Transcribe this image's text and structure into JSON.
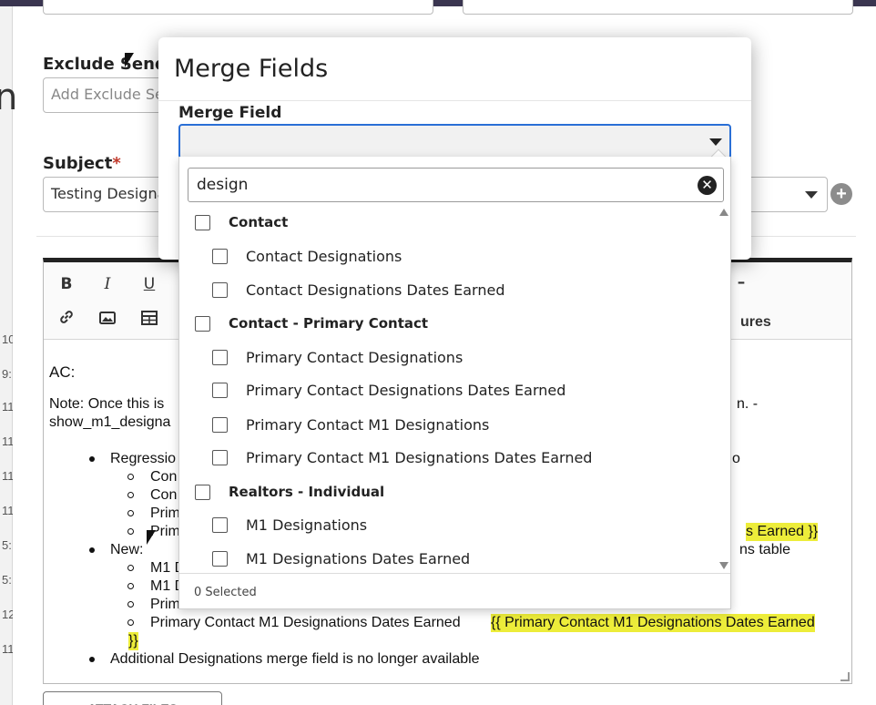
{
  "background": {
    "exclude_label": "Exclude Sendin",
    "exclude_placeholder": "Add Exclude Se",
    "subject_label": "Subject",
    "subject_required": "*",
    "subject_value": "Testing Designa",
    "big_letter": "n",
    "gutter_numbers": [
      "10",
      "9:",
      "11",
      "11",
      "11",
      "11",
      "5:",
      "5:",
      "12",
      "11"
    ]
  },
  "editor": {
    "toolbar": {
      "bold": "B",
      "italic": "I",
      "underline": "U",
      "dash": "–",
      "right_label": "ures"
    },
    "lines": {
      "ac": "AC:",
      "note_left": "Note: Once this is",
      "note_right": "n. -",
      "note_line2": "show_m1_designa",
      "regression_left": "Regressio",
      "regression_right": "o",
      "sub1": "Con",
      "sub2": "Con",
      "sub3": "Prim",
      "sub4_left": "Prim",
      "sub4_right": "s Earned }}",
      "new_left": "New:",
      "new_right": "ns table",
      "new_sub1": "M1 D",
      "new_sub2": "M1 D",
      "new_sub3": "Prim",
      "new_sub4_text": "Primary Contact M1 Designations Dates Earned",
      "new_sub4_merge": "{{ Primary Contact M1 Designations Dates Earned",
      "new_sub4_merge_end": "}}",
      "additional": "Additional Designations merge field is no longer available"
    }
  },
  "attach_button": "ATTACH FILES",
  "modal": {
    "title": "Merge Fields",
    "merge_field_label": "Merge Field",
    "merge_field_value": ""
  },
  "dropdown": {
    "search_value": "design",
    "clear_symbol": "✕",
    "groups": [
      {
        "label": "Contact",
        "items": [
          "Contact Designations",
          "Contact Designations Dates Earned"
        ]
      },
      {
        "label": "Contact - Primary Contact",
        "items": [
          "Primary Contact Designations",
          "Primary Contact Designations Dates Earned",
          "Primary Contact M1 Designations",
          "Primary Contact M1 Designations Dates Earned"
        ]
      },
      {
        "label": "Realtors - Individual",
        "items": [
          "M1 Designations",
          "M1 Designations Dates Earned"
        ]
      }
    ],
    "selected_count": "0 Selected"
  },
  "colors": {
    "focus_border": "#2a6fd6",
    "highlight": "#eded3a",
    "required": "#c0392b",
    "topbar": "#3a3550"
  }
}
